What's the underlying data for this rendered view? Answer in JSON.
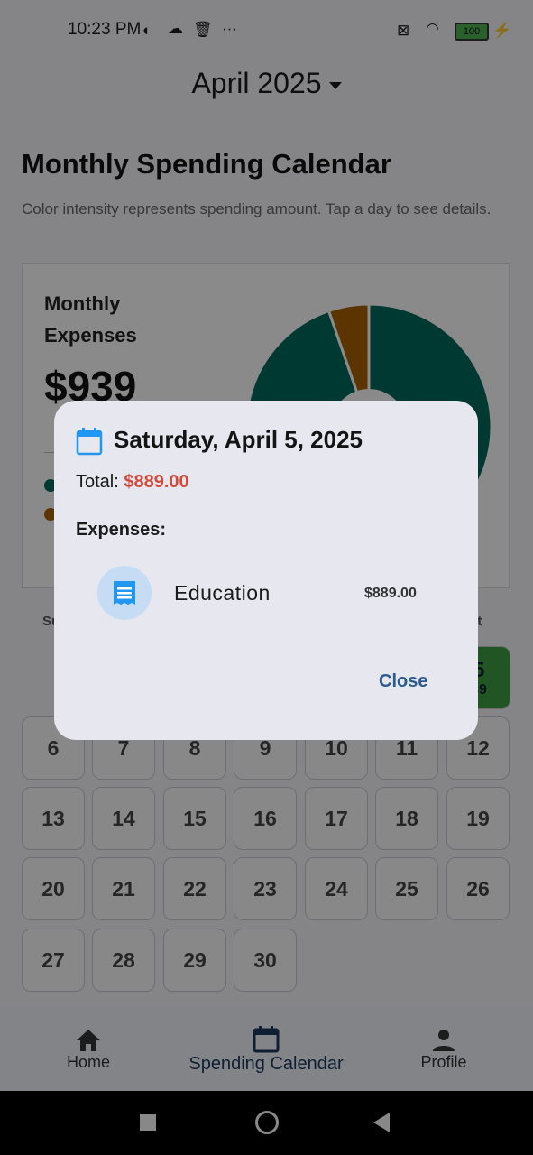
{
  "status_bar": {
    "time": "10:23 PM",
    "more": "···",
    "battery": "100"
  },
  "header": {
    "month_label": "April 2025"
  },
  "page": {
    "title": "Monthly Spending Calendar",
    "subtitle": "Color intensity represents spending amount. Tap a day to see details."
  },
  "summary_card": {
    "label": "Monthly Expenses",
    "amount": "$939",
    "colors": {
      "teal": "#00695c",
      "orange": "#a65f00"
    },
    "donut_slices": [
      {
        "color": "#00695c",
        "percent": 94.7
      },
      {
        "color": "#a65f00",
        "percent": 5.3
      }
    ]
  },
  "calendar": {
    "weekday_labels": [
      "Su",
      "",
      "",
      "",
      "",
      "",
      "at"
    ],
    "highlighted_day": {
      "day": "5",
      "amount": "89"
    },
    "rows": [
      [
        "6",
        "7",
        "8",
        "9",
        "10",
        "11",
        "12"
      ],
      [
        "13",
        "14",
        "15",
        "16",
        "17",
        "18",
        "19"
      ],
      [
        "20",
        "21",
        "22",
        "23",
        "24",
        "25",
        "26"
      ],
      [
        "27",
        "28",
        "29",
        "30"
      ]
    ]
  },
  "bottom_nav": {
    "items": [
      {
        "label": "Home",
        "icon": "home-icon"
      },
      {
        "label": "Spending Calendar",
        "icon": "calendar-icon",
        "active": true
      },
      {
        "label": "Profile",
        "icon": "person-icon"
      }
    ]
  },
  "dialog": {
    "title": "Saturday, April 5, 2025",
    "total_label": "Total: ",
    "total_value": "$889.00",
    "expenses_heading": "Expenses:",
    "expenses": [
      {
        "category": "Education",
        "amount": "$889.00",
        "icon": "receipt-icon"
      }
    ],
    "close_label": "Close"
  }
}
